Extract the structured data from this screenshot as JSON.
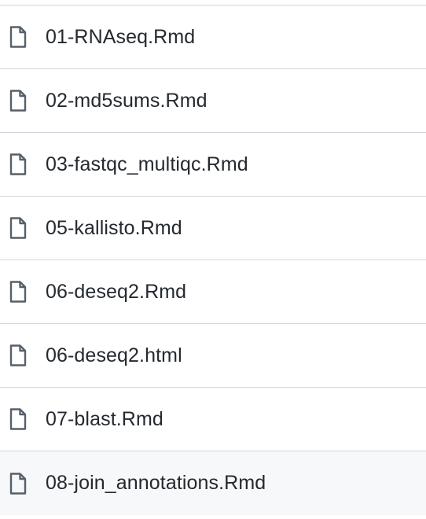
{
  "file_list": {
    "icon": "file-icon",
    "colors": {
      "text": "#24292f",
      "icon": "#57606a",
      "divider": "#d0d7de",
      "hover_background": "#f6f8fa"
    },
    "items": [
      {
        "name": "01-RNAseq.Rmd"
      },
      {
        "name": "02-md5sums.Rmd"
      },
      {
        "name": "03-fastqc_multiqc.Rmd"
      },
      {
        "name": "05-kallisto.Rmd"
      },
      {
        "name": "06-deseq2.Rmd"
      },
      {
        "name": "06-deseq2.html"
      },
      {
        "name": "07-blast.Rmd"
      },
      {
        "name": "08-join_annotations.Rmd"
      }
    ]
  }
}
